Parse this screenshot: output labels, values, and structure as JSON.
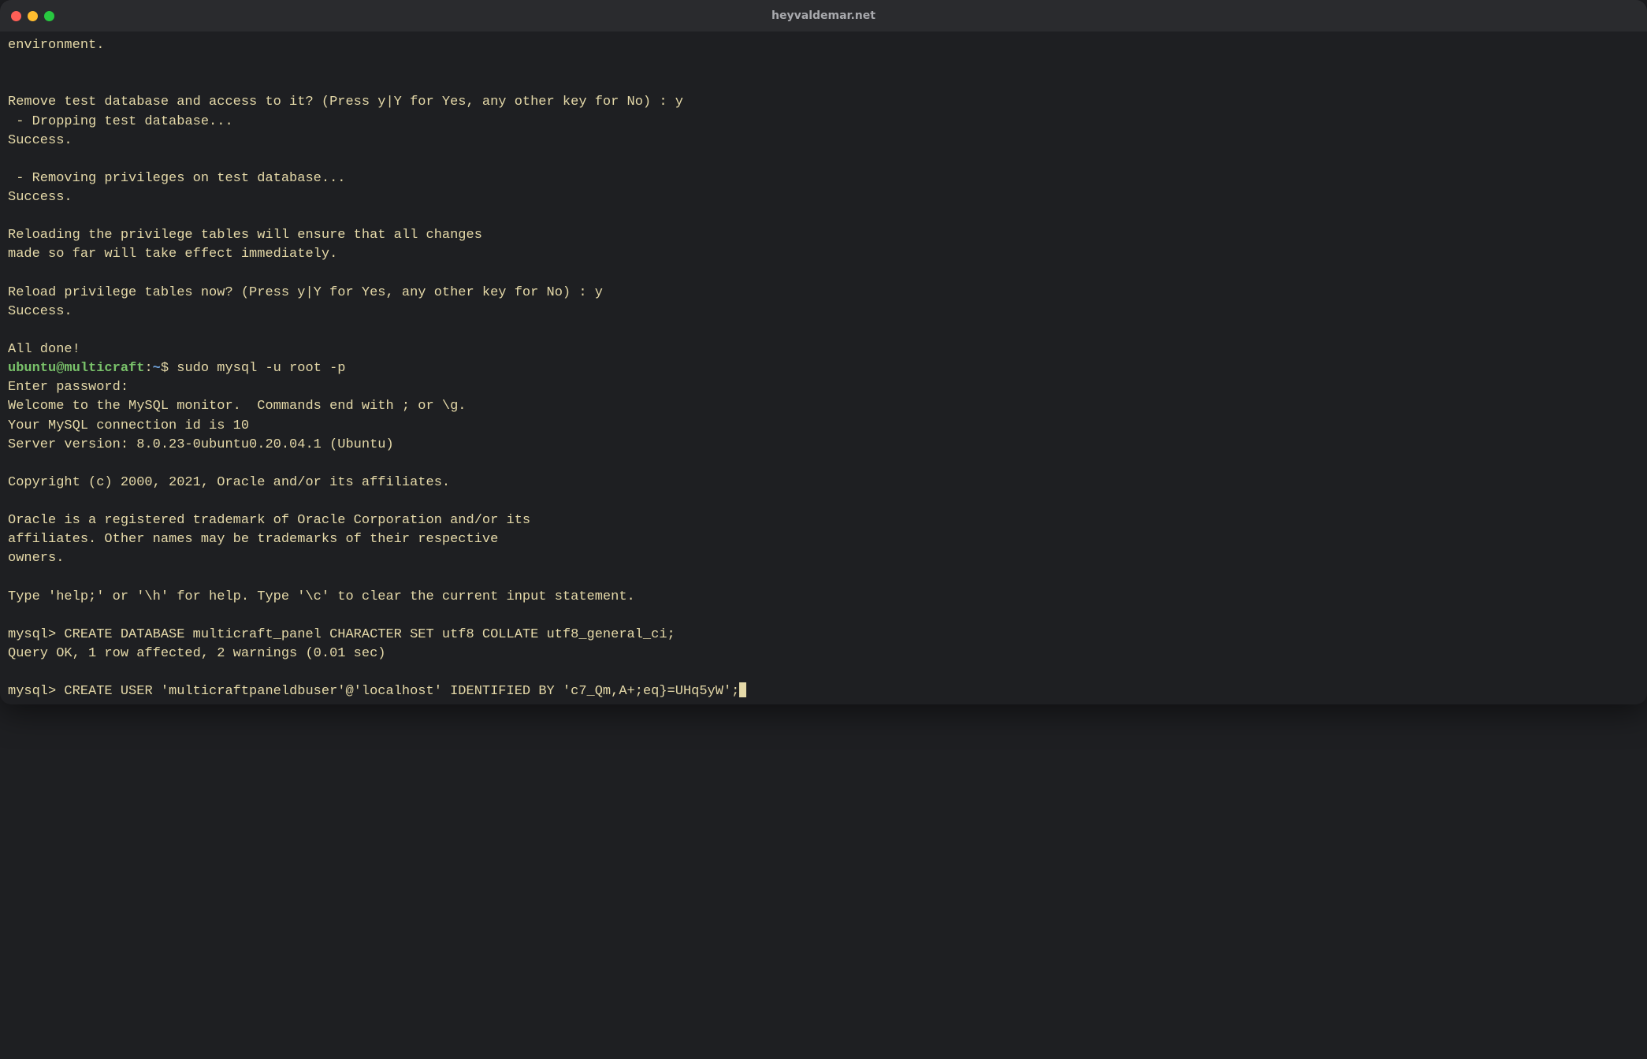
{
  "window": {
    "title": "heyvaldemar.net"
  },
  "prompt": {
    "user": "ubuntu",
    "at": "@",
    "host": "multicraft",
    "colon": ":",
    "path": "~",
    "dollar": "$"
  },
  "commands": {
    "sudo_mysql": "sudo mysql -u root -p",
    "create_user": "CREATE USER 'multicraftpaneldbuser'@'localhost' IDENTIFIED BY 'c7_Qm,A+;eq}=UHq5yW';"
  },
  "lines": {
    "l0": "environment.",
    "blank": "",
    "l1": "Remove test database and access to it? (Press y|Y for Yes, any other key for No) : y",
    "l2": " - Dropping test database...",
    "l3": "Success.",
    "l4": " - Removing privileges on test database...",
    "l5": "Success.",
    "l6": "Reloading the privilege tables will ensure that all changes",
    "l7": "made so far will take effect immediately.",
    "l8": "Reload privilege tables now? (Press y|Y for Yes, any other key for No) : y",
    "l9": "Success.",
    "l10": "All done!",
    "l11": "Enter password:",
    "l12": "Welcome to the MySQL monitor.  Commands end with ; or \\g.",
    "l13": "Your MySQL connection id is 10",
    "l14": "Server version: 8.0.23-0ubuntu0.20.04.1 (Ubuntu)",
    "l15": "Copyright (c) 2000, 2021, Oracle and/or its affiliates.",
    "l16": "Oracle is a registered trademark of Oracle Corporation and/or its",
    "l17": "affiliates. Other names may be trademarks of their respective",
    "l18": "owners.",
    "l19": "Type 'help;' or '\\h' for help. Type '\\c' to clear the current input statement.",
    "l20": "mysql> CREATE DATABASE multicraft_panel CHARACTER SET utf8 COLLATE utf8_general_ci;",
    "l21": "Query OK, 1 row affected, 2 warnings (0.01 sec)",
    "l22_prefix": "mysql> "
  }
}
